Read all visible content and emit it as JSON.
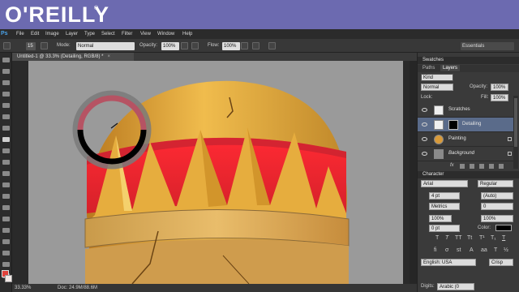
{
  "banner": {
    "logo": "O'REILLY",
    "reg": "®"
  },
  "menubar": {
    "app_icon": "Ps",
    "items": [
      "File",
      "Edit",
      "Image",
      "Layer",
      "Type",
      "Select",
      "Filter",
      "View",
      "Window",
      "Help"
    ]
  },
  "options": {
    "brush_size": "15",
    "mode_label": "Mode:",
    "mode_value": "Normal",
    "opacity_label": "Opacity:",
    "opacity_value": "100%",
    "flow_label": "Flow:",
    "flow_value": "100%",
    "workspace": "Essentials"
  },
  "document": {
    "tab_title": "Untitled-1 @ 33.3% (Detailing, RGB/8) *",
    "close": "×"
  },
  "status": {
    "zoom": "33.33%",
    "doc": "Doc: 24.9M/88.6M"
  },
  "panel": {
    "swatches_tab": "Swatches",
    "paths_tab": "Paths",
    "layers_tab": "Layers",
    "filter_kind": "Kind",
    "blend_mode": "Normal",
    "opacity_label": "Opacity:",
    "opacity_value": "100%",
    "lock_label": "Lock:",
    "fill_label": "Fill:",
    "fill_value": "100%",
    "layers": [
      {
        "name": "Scratches",
        "selected": false
      },
      {
        "name": "Detailing",
        "selected": true
      },
      {
        "name": "Painting",
        "selected": false
      },
      {
        "name": "Background",
        "selected": false
      }
    ],
    "fx": "fx",
    "character_tab": "Character",
    "font_family": "Arial",
    "font_style": "Regular",
    "font_size": "4 pt",
    "leading": "(Auto)",
    "kerning": "Metrics",
    "tracking": "0",
    "vscale": "100%",
    "hscale": "100%",
    "baseline": "0 pt",
    "color_label": "Color:",
    "language": "English: USA",
    "antialias": "Crisp",
    "digits_label": "Digits:",
    "digits_value": "Arabic (0"
  },
  "colors": {
    "banner": "#6c6ab0",
    "helmet_gold": "#e0a83c",
    "helmet_band": "#e8242c",
    "ring_red": "#b65363",
    "selected_layer": "#5a6b8a"
  }
}
